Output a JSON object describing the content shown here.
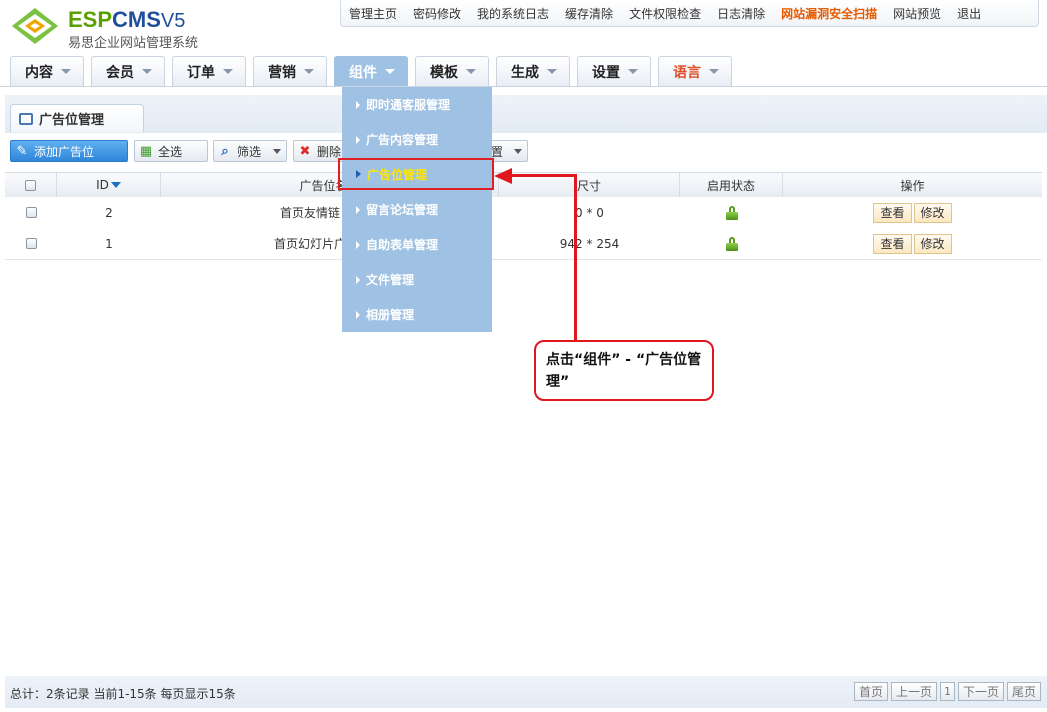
{
  "app": {
    "brand_esp": "ESP",
    "brand_cms": "CMS",
    "brand_ver": "V5",
    "subtitle": "易思企业网站管理系统"
  },
  "topnav": [
    "管理主页",
    "密码修改",
    "我的系统日志",
    "缓存清除",
    "文件权限检查",
    "日志清除",
    "网站漏洞安全扫描",
    "网站预览",
    "退出"
  ],
  "mainnav": [
    "内容",
    "会员",
    "订单",
    "营销",
    "组件",
    "模板",
    "生成",
    "设置",
    "语言"
  ],
  "page_tab": "广告位管理",
  "toolbar": {
    "add": "添加广告位",
    "select_all": "全选",
    "filter": "筛选",
    "delete": "删除",
    "settings_partial": "置"
  },
  "table": {
    "headers": {
      "id": "ID",
      "name": "广告位名称",
      "size": "尺寸",
      "status": "启用状态",
      "actions": "操作"
    },
    "rows": [
      {
        "id": "2",
        "name": "首页友情链",
        "size": "0 * 0",
        "view": "查看",
        "edit": "修改"
      },
      {
        "id": "1",
        "name": "首页幻灯片广",
        "size": "942 * 254",
        "view": "查看",
        "edit": "修改"
      }
    ]
  },
  "dropdown": [
    "即时通客服管理",
    "广告内容管理",
    "广告位管理",
    "留言论坛管理",
    "自助表单管理",
    "文件管理",
    "相册管理"
  ],
  "callout": "点击“组件” - “广告位管理”",
  "footer": {
    "stats": "总计：2条记录 当前1-15条 每页显示15条",
    "pager": [
      "首页",
      "上一页",
      "1",
      "下一页",
      "尾页"
    ]
  },
  "colors": {
    "accent": "#9fc1e3",
    "highlight": "#e0181e",
    "brand_green": "#5aa000",
    "brand_blue": "#1f4f99"
  }
}
